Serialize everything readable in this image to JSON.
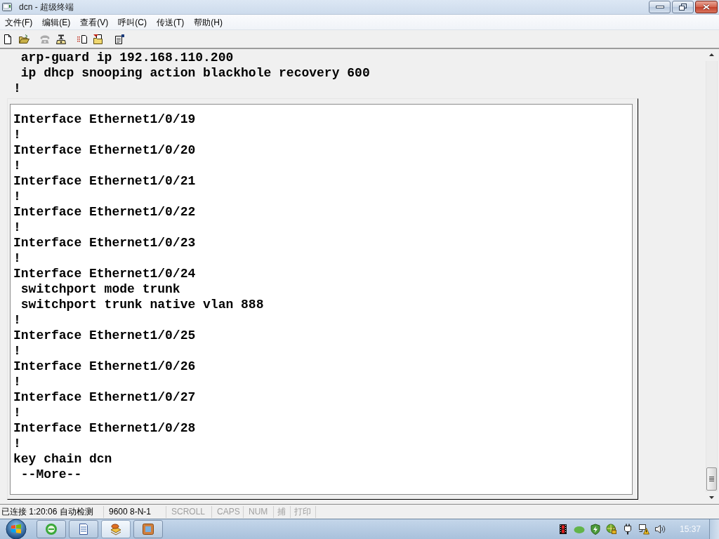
{
  "window": {
    "title": "dcn - 超级终端"
  },
  "menu": [
    "文件(F)",
    "编辑(E)",
    "查看(V)",
    "呼叫(C)",
    "传送(T)",
    "帮助(H)"
  ],
  "toolbar": [
    {
      "disabled": false
    },
    {
      "disabled": false
    },
    {
      "disabled": true
    },
    {
      "disabled": false
    },
    {
      "disabled": false
    },
    {
      "disabled": false
    },
    {
      "disabled": false
    }
  ],
  "terminal": {
    "lines": [
      " arp-guard ip 192.168.110.200",
      " ip dhcp snooping action blackhole recovery 600",
      "!"
    ],
    "panel": {
      "lines": [
        "Interface Ethernet1/0/19",
        "!",
        "Interface Ethernet1/0/20",
        "!",
        "Interface Ethernet1/0/21",
        "!",
        "Interface Ethernet1/0/22",
        "!",
        "Interface Ethernet1/0/23",
        "!",
        "Interface Ethernet1/0/24",
        " switchport mode trunk",
        " switchport trunk native vlan 888",
        "!",
        "Interface Ethernet1/0/25",
        "!",
        "Interface Ethernet1/0/26",
        "!",
        "Interface Ethernet1/0/27",
        "!",
        "Interface Ethernet1/0/28",
        "!",
        "key chain dcn",
        " --More--"
      ]
    }
  },
  "status_bar": [
    {
      "text": "已连接 1:20:06 自动检测",
      "active": true
    },
    {
      "text": "9600 8-N-1",
      "active": true
    },
    {
      "text": "SCROLL",
      "active": false
    },
    {
      "text": "CAPS",
      "active": false
    },
    {
      "text": "NUM",
      "active": false
    },
    {
      "text": "捕",
      "active": false
    },
    {
      "text": "打印",
      "active": false
    }
  ],
  "taskbar": {
    "buttons": [
      {
        "selected": false
      },
      {
        "selected": false
      },
      {
        "selected": true
      },
      {
        "selected": false
      }
    ],
    "clock": "15:37"
  }
}
